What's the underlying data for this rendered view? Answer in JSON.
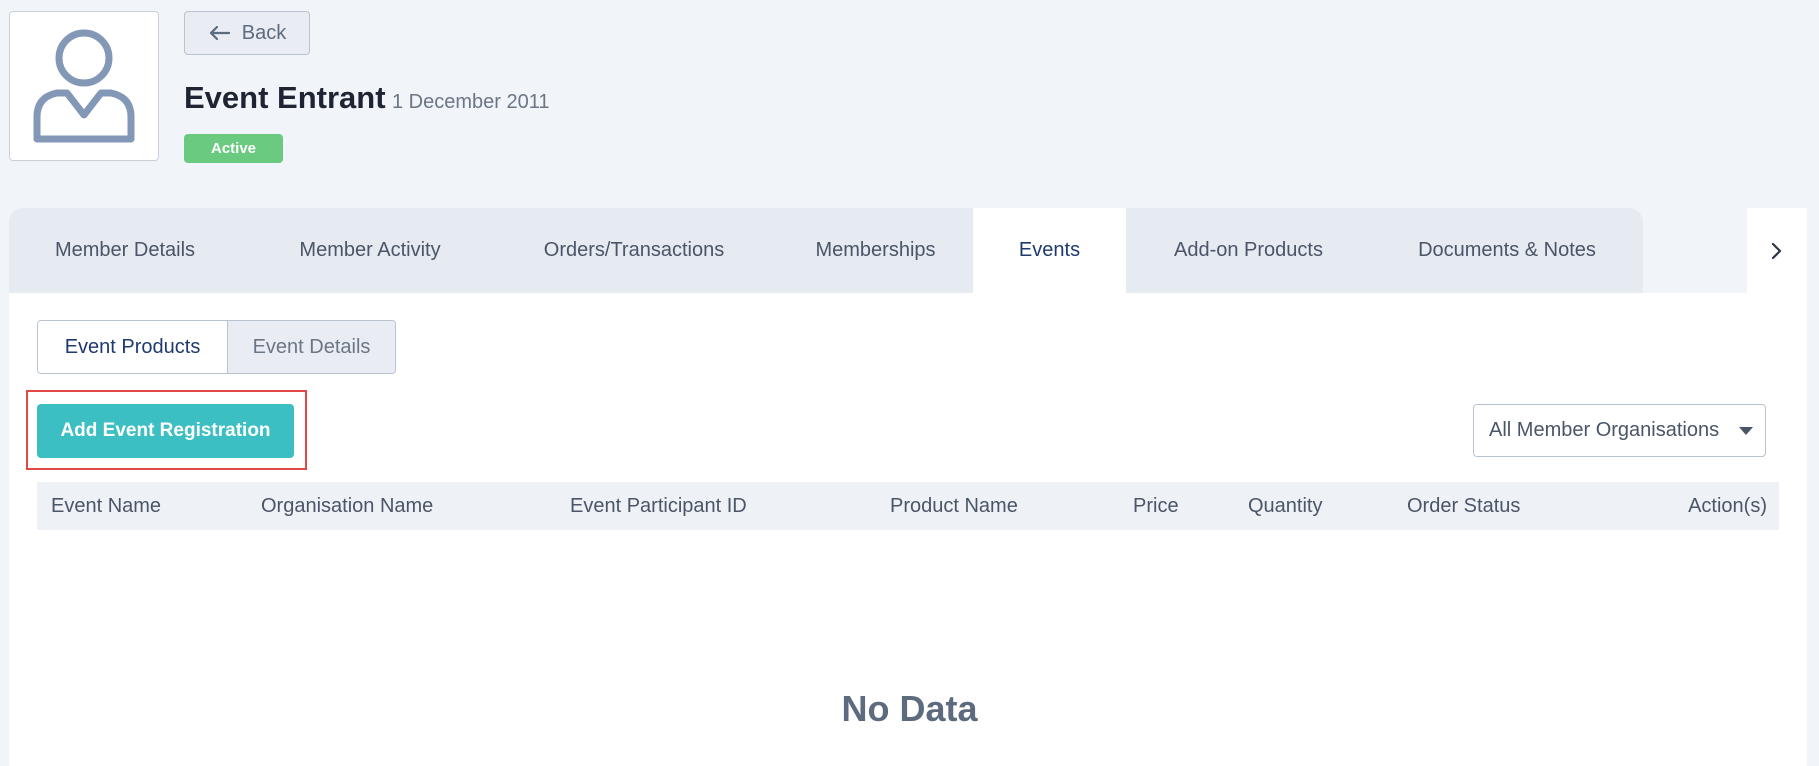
{
  "header": {
    "back_label": "Back",
    "member_name": "Event Entrant",
    "member_date": "1 December 2011",
    "status": "Active"
  },
  "tabs": [
    {
      "label": "Member Details",
      "active": false
    },
    {
      "label": "Member Activity",
      "active": false
    },
    {
      "label": "Orders/Transactions",
      "active": false
    },
    {
      "label": "Memberships",
      "active": false
    },
    {
      "label": "Events",
      "active": true
    },
    {
      "label": "Add-on Products",
      "active": false
    },
    {
      "label": "Documents & Notes",
      "active": false
    }
  ],
  "subtabs": [
    {
      "label": "Event Products",
      "active": true
    },
    {
      "label": "Event Details",
      "active": false
    }
  ],
  "actions": {
    "add_label": "Add Event Registration",
    "org_filter_value": "All Member Organisations"
  },
  "table": {
    "columns": [
      "Event Name",
      "Organisation Name",
      "Event Participant ID",
      "Product Name",
      "Price",
      "Quantity",
      "Order Status",
      "Action(s)"
    ],
    "rows": [],
    "empty_text": "No Data"
  },
  "colors": {
    "accent": "#3cbfc3",
    "status_active": "#6acb80",
    "highlight": "#e04848"
  },
  "icons": [
    "user-avatar-icon",
    "arrow-left-icon",
    "chevron-right-icon",
    "caret-down-icon"
  ]
}
